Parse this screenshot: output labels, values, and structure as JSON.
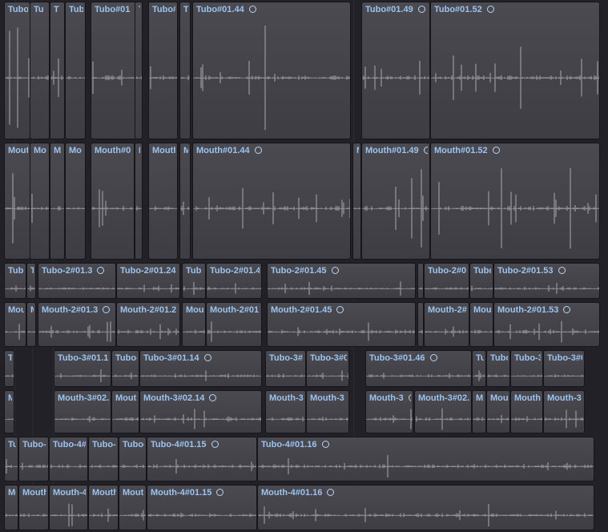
{
  "timeline": {
    "tracks": [
      {
        "name": "Tubo",
        "regions": [
          {
            "label": "Tubo"
          },
          {
            "label": "Tu"
          },
          {
            "label": "T"
          },
          {
            "label": "Tub"
          },
          {
            "label": "Tubo#01",
            "loop": true
          },
          {
            "label": "T"
          },
          {
            "label": "Tubo#"
          },
          {
            "label": "T"
          },
          {
            "label": "Tubo#01.44",
            "loop": true
          },
          {
            "label": "Tubo#01.49",
            "loop": true
          },
          {
            "label": "Tubo#01.52",
            "loop": true
          }
        ]
      },
      {
        "name": "Mouth",
        "regions": [
          {
            "label": "Mout"
          },
          {
            "label": "Mo"
          },
          {
            "label": "M"
          },
          {
            "label": "Mo"
          },
          {
            "label": "Mouth#0",
            "loop": true
          },
          {
            "label": "M"
          },
          {
            "label": "Mouth"
          },
          {
            "label": "M"
          },
          {
            "label": "Mouth#01.44",
            "loop": true
          },
          {
            "label": "M"
          },
          {
            "label": "Mouth#01.49",
            "loop": true
          },
          {
            "label": "Mouth#01.52",
            "loop": true
          }
        ]
      },
      {
        "name": "Tubo-2",
        "regions": [
          {
            "label": "Tub"
          },
          {
            "label": "T"
          },
          {
            "label": "Tubo-2#01.3",
            "loop": true
          },
          {
            "label": "Tubo-2#01.24",
            "loop": true
          },
          {
            "label": "Tub"
          },
          {
            "label": "Tubo-2#01.4",
            "loop": true
          },
          {
            "label": "Tubo-2#01.45",
            "loop": true
          },
          {
            "label": "T"
          },
          {
            "label": "Tubo-2#0",
            "loop": true
          },
          {
            "label": "Tubo"
          },
          {
            "label": "Tubo-2#01.53",
            "loop": true
          }
        ]
      },
      {
        "name": "Mouth-2",
        "regions": [
          {
            "label": "Mou"
          },
          {
            "label": "M"
          },
          {
            "label": "Mouth-2#01.3",
            "loop": true
          },
          {
            "label": "Mouth-2#01.2",
            "loop": true
          },
          {
            "label": "Mou"
          },
          {
            "label": "Mouth-2#01",
            "loop": true
          },
          {
            "label": "Mouth-2#01.45",
            "loop": true
          },
          {
            "label": "M"
          },
          {
            "label": "Mouth-2#",
            "loop": true
          },
          {
            "label": "Mou"
          },
          {
            "label": "Mouth-2#01.53",
            "loop": true
          }
        ]
      },
      {
        "name": "Tubo-3",
        "regions": [
          {
            "label": "T"
          },
          {
            "label": "Tubo-3#01.1",
            "loop": true
          },
          {
            "label": "Tubo-"
          },
          {
            "label": "Tubo-3#01.14",
            "loop": true
          },
          {
            "label": "Tubo-3#",
            "loop": true
          },
          {
            "label": "Tubo-3#0",
            "loop": true
          },
          {
            "label": "Tubo-3#01.46",
            "loop": true
          },
          {
            "label": "Tu"
          },
          {
            "label": "Tubo"
          },
          {
            "label": "Tubo-3",
            "loop": true
          },
          {
            "label": "Tubo-3#0",
            "loop": true
          }
        ]
      },
      {
        "name": "Mouth-3",
        "regions": [
          {
            "label": "M"
          },
          {
            "label": "Mouth-3#02.",
            "loop": true
          },
          {
            "label": "Mouth"
          },
          {
            "label": "Mouth-3#02.14",
            "loop": true
          },
          {
            "label": "Mouth-3",
            "loop": true
          },
          {
            "label": "Mouth-3",
            "loop": true
          },
          {
            "label": "Mouth-3",
            "loop": true
          },
          {
            "label": "Mouth-3#02.",
            "loop": true
          },
          {
            "label": "M"
          },
          {
            "label": "Mou"
          },
          {
            "label": "Mouth-",
            "loop": true
          },
          {
            "label": "Mouth-3",
            "loop": true
          }
        ]
      },
      {
        "name": "Tubo-4",
        "regions": [
          {
            "label": "Tu"
          },
          {
            "label": "Tubo-"
          },
          {
            "label": "Tubo-4#",
            "loop": true
          },
          {
            "label": "Tubo-"
          },
          {
            "label": "Tubo-"
          },
          {
            "label": "Tubo-4#01.15",
            "loop": true
          },
          {
            "label": "Tubo-4#01.16",
            "loop": true
          }
        ]
      },
      {
        "name": "Mouth-4",
        "regions": [
          {
            "label": "Mo"
          },
          {
            "label": "Mouth"
          },
          {
            "label": "Mouth-4",
            "loop": true
          },
          {
            "label": "Mouth"
          },
          {
            "label": "Mout"
          },
          {
            "label": "Mouth-4#01.15",
            "loop": true
          },
          {
            "label": "Mouth-4#01.16",
            "loop": true
          }
        ]
      }
    ]
  },
  "colors": {
    "region_fill": "#444449",
    "region_label": "#9cc3ef",
    "waveform": "#a9a9ae",
    "lane_background": "#222128"
  },
  "icons": {
    "loop": "loop-icon"
  }
}
